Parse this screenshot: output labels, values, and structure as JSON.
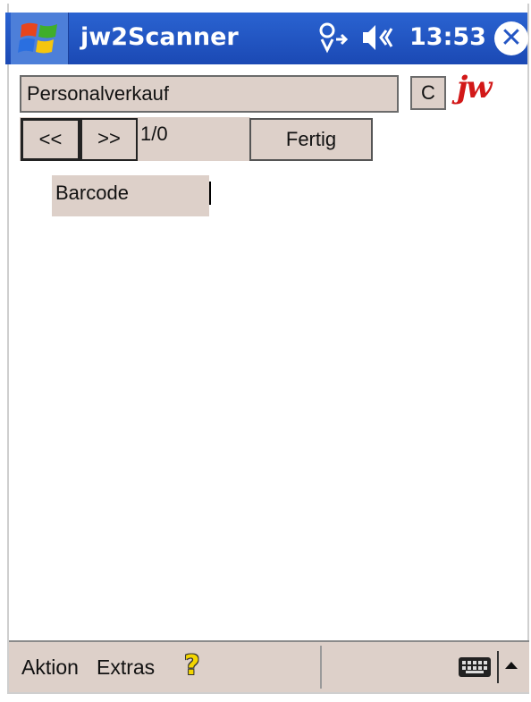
{
  "titlebar": {
    "app_title": "jw2Scanner",
    "time": "13:53",
    "icons": [
      "windows-start-icon",
      "connectivity-icon",
      "speaker-icon",
      "close-icon"
    ]
  },
  "main": {
    "combo_value": "Personalverkauf",
    "clear_label": "C",
    "logo_text": "jw",
    "prev_label": "<<",
    "next_label": ">>",
    "page_count": "1/0",
    "done_label": "Fertig",
    "barcode_label": "Barcode"
  },
  "menubar": {
    "aktion_label": "Aktion",
    "extras_label": "Extras",
    "icons": [
      "help-icon",
      "keyboard-icon",
      "input-arrow-icon"
    ]
  },
  "colors": {
    "titlebar": "#1b49b4",
    "field": "#ddd0c9",
    "logo": "#d21818"
  }
}
